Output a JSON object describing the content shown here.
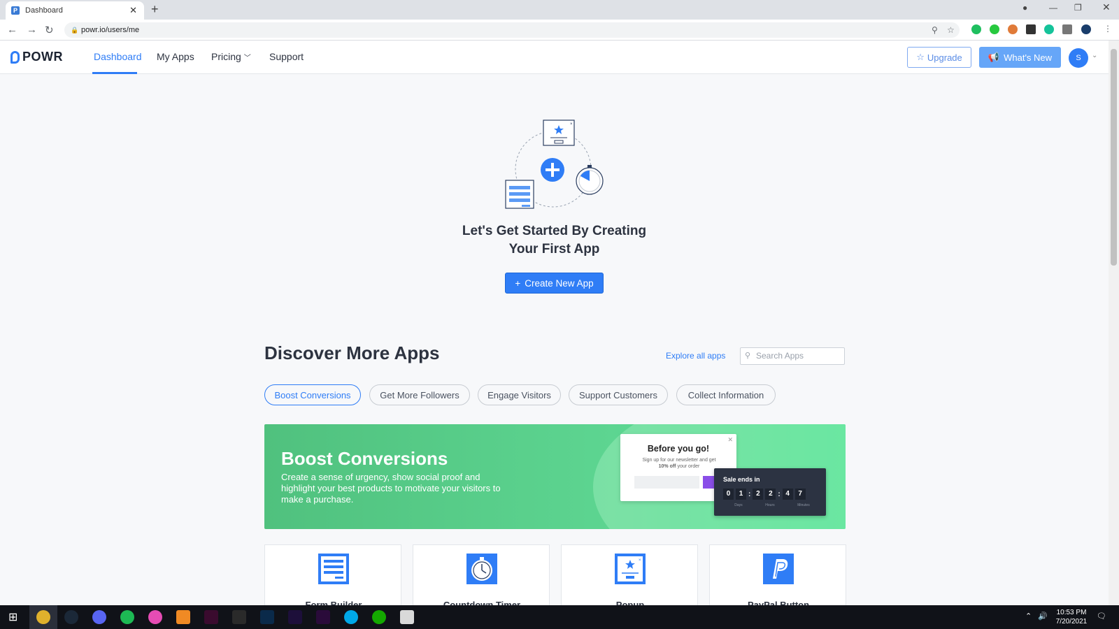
{
  "browser": {
    "tab_title": "Dashboard",
    "url": "powr.io/users/me"
  },
  "header": {
    "logo": "POWR",
    "nav": [
      "Dashboard",
      "My Apps",
      "Pricing",
      "Support"
    ],
    "upgrade_label": "Upgrade",
    "whats_new_label": "What's New",
    "avatar_initial": "S"
  },
  "hero": {
    "title_line1": "Let's Get Started By Creating",
    "title_line2": "Your First App",
    "create_label": "Create New App"
  },
  "discover": {
    "title": "Discover More Apps",
    "explore_label": "Explore all apps",
    "search_placeholder": "Search Apps",
    "categories": [
      "Boost Conversions",
      "Get More Followers",
      "Engage Visitors",
      "Support Customers",
      "Collect Information"
    ],
    "active_category": "Boost Conversions"
  },
  "banner": {
    "title": "Boost Conversions",
    "description": "Create a sense of urgency, show social proof and highlight your best products to motivate your visitors to make a purchase.",
    "popup_title": "Before you go!",
    "popup_text_1": "Sign up for our newsletter and get",
    "popup_text_bold": "10% off",
    "popup_text_2": "your order",
    "timer_title": "Sale ends in",
    "timer_digits": [
      "0",
      "1",
      "2",
      "2",
      "4",
      "7"
    ],
    "timer_labels": [
      "Days",
      "Hours",
      "Minutes"
    ]
  },
  "apps": [
    {
      "name": "Form Builder",
      "icon": "form-builder-icon"
    },
    {
      "name": "Countdown Timer",
      "icon": "countdown-timer-icon"
    },
    {
      "name": "Popup",
      "icon": "popup-icon"
    },
    {
      "name": "PayPal Button",
      "icon": "paypal-icon"
    }
  ],
  "taskbar": {
    "time": "10:53 PM",
    "date": "7/20/2021"
  },
  "colors": {
    "accent": "#2f7df6",
    "banner_green": "#50c17e",
    "whats_new": "#66a6f8"
  }
}
